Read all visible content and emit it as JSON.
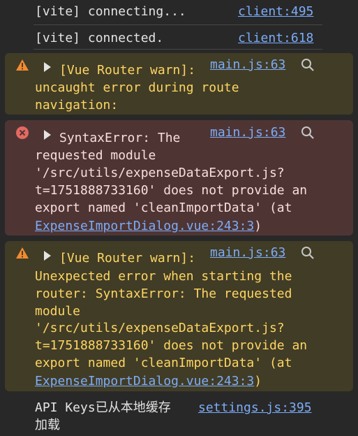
{
  "colors": {
    "background": "#282828",
    "text": "#e3e3e3",
    "link": "#7cacf8",
    "warning_bg": "#413c26",
    "warning_text": "#fdd663",
    "error_bg": "#4e3534",
    "error_text": "#f9dedc",
    "warning_icon": "#f28b30",
    "error_icon": "#e46962"
  },
  "messages": [
    {
      "level": "log",
      "text": "[vite] connecting...",
      "source": "client:495"
    },
    {
      "level": "log",
      "text": "[vite] connected.",
      "source": "client:618"
    },
    {
      "level": "warning",
      "icon": "warning-triangle-icon",
      "source": "main.js:63",
      "lines": [
        "[Vue Router warn]:",
        "uncaught error during route",
        "navigation:"
      ]
    },
    {
      "level": "error",
      "icon": "error-circle-icon",
      "source": "main.js:63",
      "lines": [
        "SyntaxError: The",
        "requested module",
        "'/src/utils/expenseDataExport.js?",
        "t=1751888733160' does not provide an",
        "export named 'cleanImportData' (at"
      ],
      "location_link": "ExpenseImportDialog.vue:243:3",
      "location_close": ")"
    },
    {
      "level": "warning",
      "icon": "warning-triangle-icon",
      "source": "main.js:63",
      "lines": [
        "[Vue Router warn]:",
        "Unexpected error when starting the",
        "router: SyntaxError: The requested",
        "module",
        "'/src/utils/expenseDataExport.js?",
        "t=1751888733160' does not provide an",
        "export named 'cleanImportData' (at"
      ],
      "location_link": "ExpenseImportDialog.vue:243:3",
      "location_close": ")"
    },
    {
      "level": "log",
      "lines": [
        "API Keys已从本地缓存",
        "加载"
      ],
      "source": "settings.js:395"
    }
  ]
}
